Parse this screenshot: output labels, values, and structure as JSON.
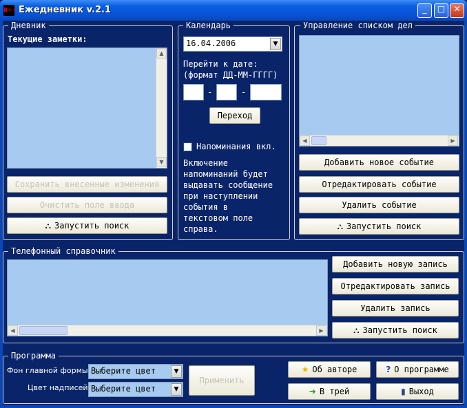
{
  "window": {
    "title": "Ежедневник v.2.1",
    "icon_text": "В++",
    "minimize_glyph": "_",
    "maximize_glyph": "□",
    "close_glyph": "✕"
  },
  "diary": {
    "legend": "Дневник",
    "notes_label": "Текущие заметки:",
    "save_label": "Сохранить внесенные изменения",
    "clear_label": "Очистить поле ввода",
    "search_label": "Запустить поиск"
  },
  "calendar": {
    "legend": "Календарь",
    "date_value": "16.04.2006",
    "goto_line1": "Перейти к дате:",
    "goto_line2": "(формат ДД-ММ-ГГГГ)",
    "dash": "-",
    "go_label": "Переход",
    "reminders_label": "Напоминания вкл.",
    "description": [
      "Включение",
      "напоминаний будет",
      "выдавать сообщение",
      "при наступлении",
      "события в",
      "текстовом поле",
      "справа."
    ]
  },
  "tasks": {
    "legend": "Управление списком дел",
    "add_label": "Добавить новое событие",
    "edit_label": "Отредактировать событие",
    "delete_label": "Удалить событие",
    "search_label": "Запустить поиск"
  },
  "phonebook": {
    "legend": "Телефонный справочник",
    "add_label": "Добавить новую запись",
    "edit_label": "Отредактировать запись",
    "delete_label": "Удалить запись",
    "search_label": "Запустить поиск"
  },
  "program": {
    "legend": "Программа",
    "bg_label": "Фон главной формы:",
    "text_label": "Цвет надписей:",
    "bg_value": "Выберите цвет",
    "text_value": "Выберите цвет",
    "apply_label": "Применить",
    "about_author_label": "Об авторе",
    "about_program_label": "О программе",
    "tray_label": "В трей",
    "exit_label": "Выход"
  },
  "icons": {
    "search": "binoculars-icon",
    "about_author": "star-icon",
    "about_program": "question-icon",
    "tray": "arrow-right-icon",
    "exit": "exit-door-icon"
  },
  "colors": {
    "background": "#0a246a",
    "pane": "#a6caf0",
    "titlebar": "#0853d8"
  }
}
